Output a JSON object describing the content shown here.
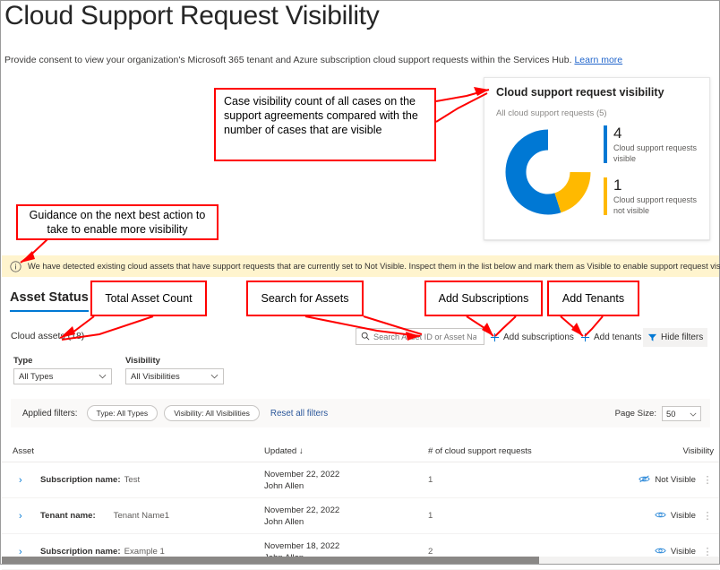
{
  "header": {
    "title": "Cloud Support Request Visibility",
    "subtitle": "Provide consent to view your organization's Microsoft 365 tenant and Azure subscription cloud support requests within the Services Hub.",
    "learn_more": "Learn more"
  },
  "colors": {
    "visible_blue": "#0078D4",
    "not_visible_amber": "#FFB900",
    "accent": "#0078D4",
    "info_bar_bg": "#FFF4CE",
    "annotation_red": "#FF0000"
  },
  "donut_card": {
    "title": "Cloud support request visibility",
    "subtitle": "All cloud support requests (5)",
    "legend": [
      {
        "value": "4",
        "label": "Cloud support requests visible",
        "color": "#0078D4"
      },
      {
        "value": "1",
        "label": "Cloud support requests not visible",
        "color": "#FFB900"
      }
    ]
  },
  "chart_data": {
    "type": "pie",
    "title": "Cloud support request visibility",
    "subtitle": "All cloud support requests (5)",
    "categories": [
      "Cloud support requests visible",
      "Cloud support requests not visible"
    ],
    "values": [
      4,
      1
    ],
    "total": 5,
    "colors": [
      "#0078D4",
      "#FFB900"
    ],
    "donut": true,
    "legend_position": "right"
  },
  "info_bar": {
    "icon": "info-circle-icon",
    "message": "We have detected existing cloud assets that have support requests that are currently set to Not Visible. Inspect them in the list below and mark them as Visible to enable support request visibility.",
    "close": "✕"
  },
  "tabs": [
    {
      "label": "Asset Status",
      "active": true
    }
  ],
  "toolbar": {
    "assets_count": "Cloud assets (18)",
    "search_placeholder": "Search Asset ID or Asset Na...",
    "search_value": "",
    "add_subscriptions": "Add subscriptions",
    "add_tenants": "Add tenants",
    "hide_filters": "Hide filters"
  },
  "filters": {
    "type_label": "Type",
    "type_value": "All Types",
    "visibility_label": "Visibility",
    "visibility_value": "All Visibilities",
    "applied_label": "Applied filters:",
    "chips": [
      "Type: All Types",
      "Visibility: All Visibilities"
    ],
    "reset": "Reset all filters",
    "page_size_label": "Page Size:",
    "page_size_value": "50"
  },
  "table": {
    "columns": [
      "Asset",
      "Updated",
      "# of cloud support requests",
      "Visibility"
    ],
    "sort_indicator": "↓",
    "rows": [
      {
        "asset_type": "Subscription name:",
        "asset_name": "Test",
        "updated_date": "November 22, 2022",
        "updated_by": "John Allen",
        "request_count": "1",
        "visibility": "Not Visible",
        "visibility_icon": "eye-slash-icon"
      },
      {
        "asset_type": "Tenant name:",
        "asset_name": "Tenant Name1",
        "updated_date": "November 22, 2022",
        "updated_by": "John Allen",
        "request_count": "1",
        "visibility": "Visible",
        "visibility_icon": "eye-icon"
      },
      {
        "asset_type": "Subscription name:",
        "asset_name": "Example 1",
        "updated_date": "November 18, 2022",
        "updated_by": "John Allen",
        "request_count": "2",
        "visibility": "Visible",
        "visibility_icon": "eye-icon"
      }
    ]
  },
  "annotations": [
    {
      "id": "case-visibility",
      "text": "Case visibility count of all cases on the support agreements compared with the number of cases that are visible"
    },
    {
      "id": "guidance",
      "text": "Guidance on the next best action to take to enable more visibility"
    },
    {
      "id": "total-asset-count",
      "text": "Total Asset Count"
    },
    {
      "id": "search-for-assets",
      "text": "Search for Assets"
    },
    {
      "id": "add-subscriptions",
      "text": "Add Subscriptions"
    },
    {
      "id": "add-tenants",
      "text": "Add Tenants"
    }
  ]
}
